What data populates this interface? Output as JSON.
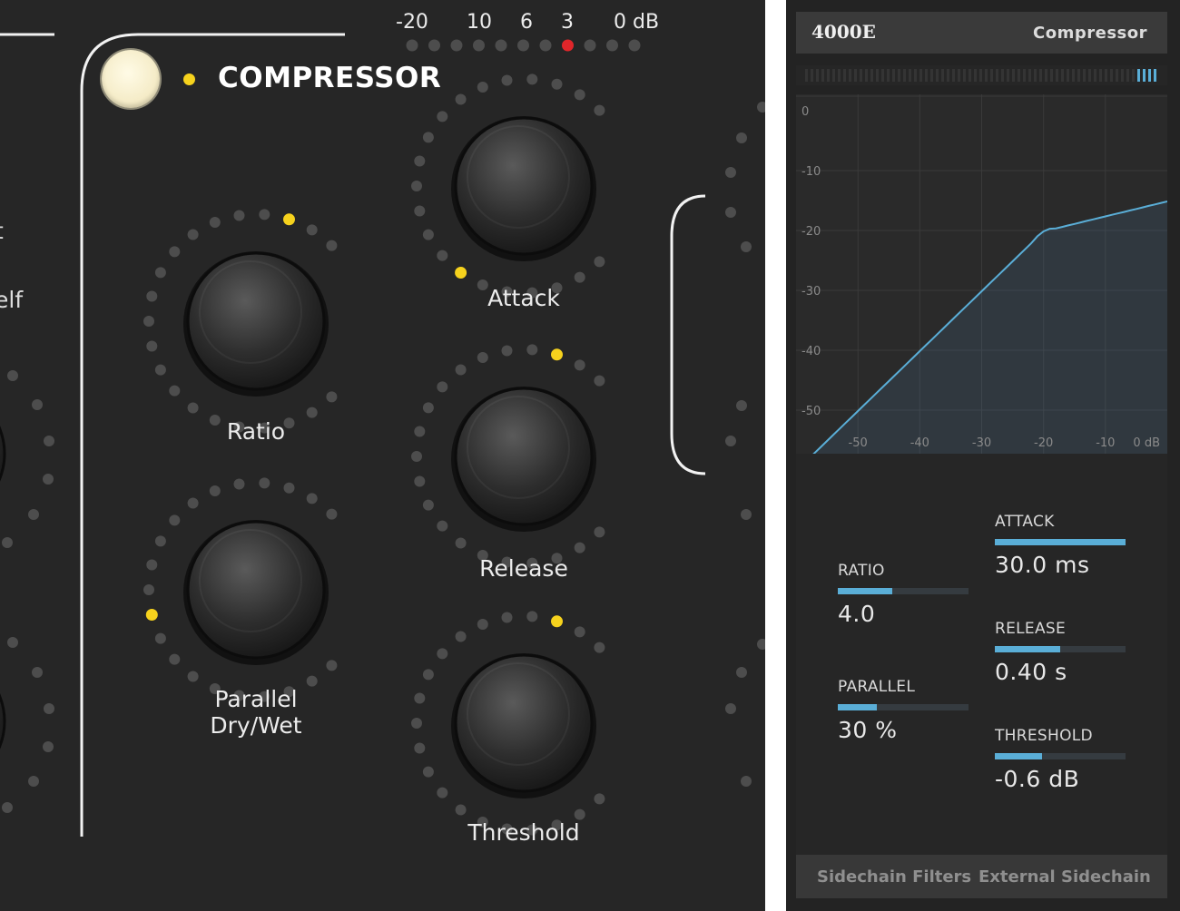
{
  "hardware": {
    "title": "COMPRESSOR",
    "meter": {
      "labels": [
        "-20",
        "10",
        "6",
        "3",
        "0 dB"
      ],
      "active_segment": 7
    },
    "left_fragments": [
      "t",
      "l",
      "elf"
    ],
    "knobs": {
      "ratio": {
        "label": "Ratio"
      },
      "parallel": {
        "label": "Parallel\nDry/Wet"
      },
      "attack": {
        "label": "Attack"
      },
      "release": {
        "label": "Release"
      },
      "threshold": {
        "label": "Threshold"
      }
    }
  },
  "plugin": {
    "model": "4000E",
    "title": "Compressor",
    "graph": {
      "y_labels": [
        "0",
        "-10",
        "-20",
        "-30",
        "-40",
        "-50"
      ],
      "x_labels": [
        "-50",
        "-40",
        "-30",
        "-20",
        "-10",
        "0 dB"
      ]
    },
    "params": {
      "ratio": {
        "label": "RATIO",
        "value": "4.0",
        "fill": 0.42
      },
      "parallel": {
        "label": "PARALLEL",
        "value": "30 %",
        "fill": 0.3
      },
      "attack": {
        "label": "ATTACK",
        "value": "30.0 ms",
        "fill": 1.0
      },
      "release": {
        "label": "RELEASE",
        "value": "0.40 s",
        "fill": 0.5
      },
      "threshold": {
        "label": "THRESHOLD",
        "value": "-0.6 dB",
        "fill": 0.36
      }
    },
    "footer": {
      "sidechain_filters": "Sidechain Filters",
      "external_sidechain": "External Sidechain"
    }
  },
  "colors": {
    "accent_blue": "#5aaed7",
    "led_yellow": "#f6d21d",
    "led_red": "#e0262a",
    "dot_grey": "#4d4d4d"
  }
}
